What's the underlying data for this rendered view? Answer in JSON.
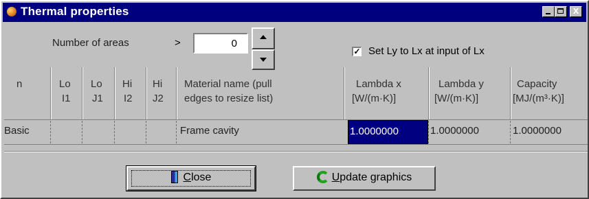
{
  "window": {
    "title": "Thermal properties",
    "controls": {
      "minimize": "_",
      "maximize": "□",
      "close": "x"
    }
  },
  "areas": {
    "label": "Number of areas",
    "arrow": ">",
    "value": "0"
  },
  "option": {
    "checked": true,
    "check_mark": "✓",
    "label": "Set Ly to Lx at input of Lx"
  },
  "table": {
    "headers": {
      "n": "n",
      "lo_i1": [
        "Lo",
        "I1"
      ],
      "lo_j1": [
        "Lo",
        "J1"
      ],
      "hi_i2": [
        "Hi",
        "I2"
      ],
      "hi_j2": [
        "Hi",
        "J2"
      ],
      "material": [
        "Material name (pull",
        "edges to resize list)"
      ],
      "lambda_x": [
        "Lambda x",
        "[W/(m·K)]"
      ],
      "lambda_y": [
        "Lambda y",
        "[W/(m·K)]"
      ],
      "capacity": [
        "Capacity",
        "[MJ/(m³·K)]"
      ]
    },
    "rows": [
      {
        "n": "Basic",
        "lo_i1": "",
        "lo_j1": "",
        "hi_i2": "",
        "hi_j2": "",
        "material": "Frame cavity",
        "lambda_x": "1.0000000",
        "lambda_y": "1.0000000",
        "capacity": "1.0000000"
      }
    ]
  },
  "buttons": {
    "close": {
      "pre": "",
      "accel": "C",
      "post": "lose",
      "icon": "door-icon"
    },
    "update": {
      "pre": "",
      "accel": "U",
      "post": "pdate graphics",
      "icon": "refresh-icon"
    }
  },
  "colors": {
    "titlebar": "#00007f",
    "face": "#c0c0c0",
    "selection": "#000080"
  }
}
